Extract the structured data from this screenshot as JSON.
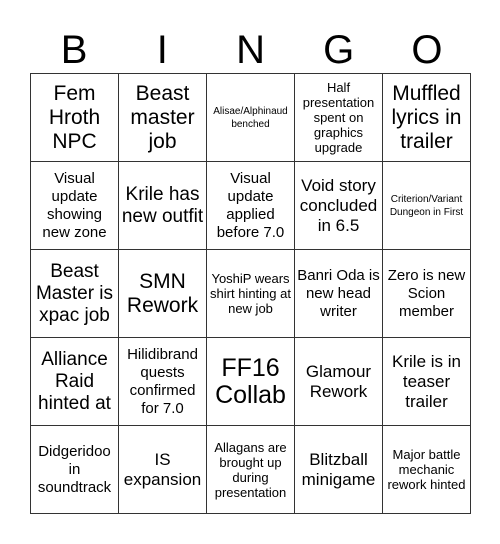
{
  "header": [
    "B",
    "I",
    "N",
    "G",
    "O"
  ],
  "cells": [
    "Fem Hroth NPC",
    "Beast master job",
    "Alisae/Alphinaud benched",
    "Half presentation spent on graphics upgrade",
    "Muffled lyrics in trailer",
    "Visual update showing new zone",
    "Krile has new outfit",
    "Visual update applied before 7.0",
    "Void story concluded in 6.5",
    "Criterion/Variant Dungeon in First",
    "Beast Master is xpac job",
    "SMN Rework",
    "YoshiP wears shirt hinting at new job",
    "Banri Oda is new head writer",
    "Zero is new Scion member",
    "Alliance Raid hinted at",
    "Hilidibrand quests confirmed for 7.0",
    "FF16 Collab",
    "Glamour Rework",
    "Krile is in teaser trailer",
    "Didgeridoo in soundtrack",
    "IS expansion",
    "Allagans are brought up during presentation",
    "Blitzball minigame",
    "Major battle mechanic rework hinted"
  ]
}
